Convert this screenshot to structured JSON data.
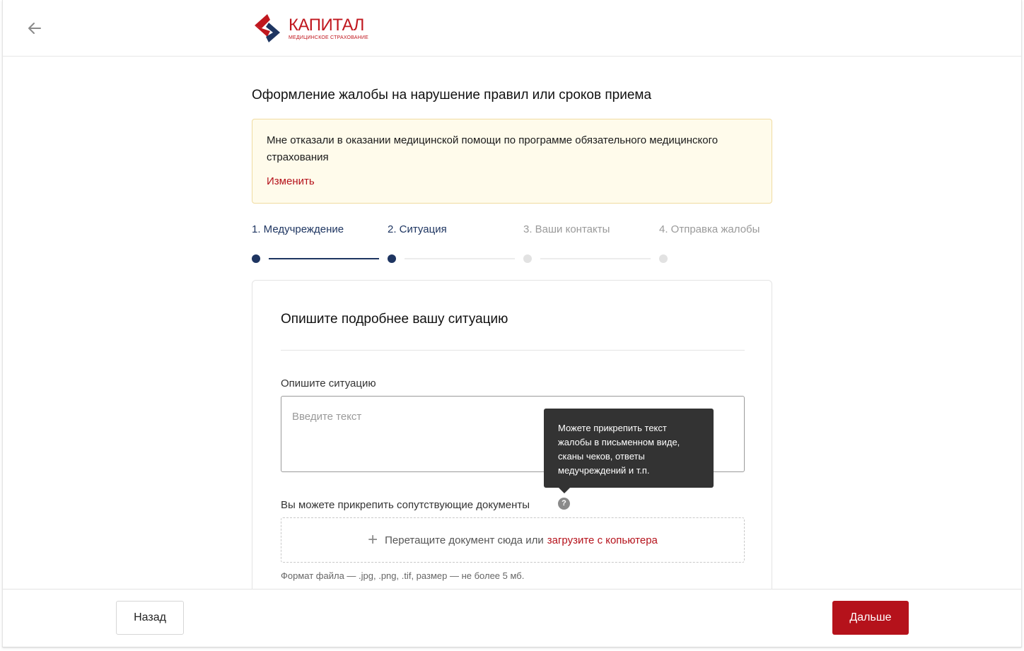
{
  "header": {
    "back_icon": "arrow-left-icon",
    "logo_title": "КАПИТАЛ",
    "logo_subtitle": "МЕДИЦИНСКОЕ СТРАХОВАНИЕ",
    "brand_color": "#c0171e",
    "brand_secondary_color": "#1e3561"
  },
  "page": {
    "title": "Оформление жалобы на нарушение правил или сроков приема"
  },
  "notice": {
    "text": "Мне отказали в оказании медицинской помощи по программе обязательного медицинского страхования",
    "change_link": "Изменить"
  },
  "steps": [
    {
      "label": "1. Медучреждение",
      "status": "done"
    },
    {
      "label": "2. Ситуация",
      "status": "current"
    },
    {
      "label": "3. Ваши контакты",
      "status": "todo"
    },
    {
      "label": "4. Отправка жалобы",
      "status": "todo"
    }
  ],
  "form": {
    "title": "Опишите подробнее вашу ситуацию",
    "description_label": "Опишите ситуацию",
    "description_placeholder": "Введите текст",
    "description_value": "",
    "attach_label": "Вы можете прикрепить сопутствующие документы",
    "help_icon": "question-mark-icon",
    "dropzone_text": "Перетащите документ сюда или",
    "dropzone_link": "загрузите с копьютера",
    "format_hint": "Формат файла — .jpg, .png, .tif, размер — не более 5 мб."
  },
  "tooltip": {
    "text": "Можете прикрепить текст жалобы в письменном виде, сканы чеков, ответы медучреждений и т.п."
  },
  "footer": {
    "back_button": "Назад",
    "next_button": "Дальше"
  }
}
